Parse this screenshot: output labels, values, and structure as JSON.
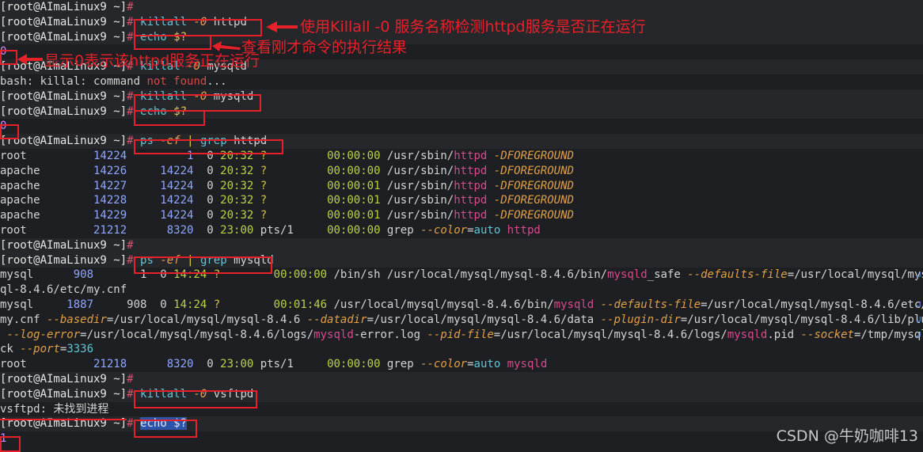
{
  "prompt": "[root@AImaLinux9 ~]",
  "lines": [
    {
      "t": "prompt",
      "rest": ""
    },
    {
      "t": "prompt",
      "cmd": "killall",
      "flag": "-0",
      "arg": "httpd"
    },
    {
      "t": "prompt",
      "cmd": "echo",
      "arg": "$?"
    },
    {
      "t": "num",
      "text": "0"
    },
    {
      "t": "prompt",
      "cmd": "killal",
      "flag": "-0",
      "arg": "mysqld"
    },
    {
      "t": "err",
      "a": "bash: killal: command ",
      "b": "not found",
      "c": "..."
    },
    {
      "t": "prompt",
      "cmd": "killall",
      "flag": "-0",
      "arg": "mysqld"
    },
    {
      "t": "prompt",
      "cmd": "echo",
      "arg": "$?"
    },
    {
      "t": "num",
      "text": "0"
    },
    {
      "t": "prompt",
      "ps": true,
      "arg": "httpd"
    },
    {
      "t": "ps",
      "user": "root",
      "pid": "14224",
      "ppid": "1",
      "c": "0",
      "stime": "20:32",
      "tty": "?",
      "time": "00:00:00",
      "path": "/usr/sbin/",
      "hl": "httpd",
      "opt": " -DFOREGROUND"
    },
    {
      "t": "ps",
      "user": "apache",
      "pid": "14226",
      "ppid": "14224",
      "c": "0",
      "stime": "20:32",
      "tty": "?",
      "time": "00:00:00",
      "path": "/usr/sbin/",
      "hl": "httpd",
      "opt": " -DFOREGROUND"
    },
    {
      "t": "ps",
      "user": "apache",
      "pid": "14227",
      "ppid": "14224",
      "c": "0",
      "stime": "20:32",
      "tty": "?",
      "time": "00:00:01",
      "path": "/usr/sbin/",
      "hl": "httpd",
      "opt": " -DFOREGROUND"
    },
    {
      "t": "ps",
      "user": "apache",
      "pid": "14228",
      "ppid": "14224",
      "c": "0",
      "stime": "20:32",
      "tty": "?",
      "time": "00:00:01",
      "path": "/usr/sbin/",
      "hl": "httpd",
      "opt": " -DFOREGROUND"
    },
    {
      "t": "ps",
      "user": "apache",
      "pid": "14229",
      "ppid": "14224",
      "c": "0",
      "stime": "20:32",
      "tty": "?",
      "time": "00:00:01",
      "path": "/usr/sbin/",
      "hl": "httpd",
      "opt": " -DFOREGROUND"
    },
    {
      "t": "psgrep",
      "user": "root",
      "pid": "21212",
      "ppid": "8320",
      "c": "0",
      "stime": "23:00",
      "tty": "pts/1",
      "time": "00:00:00",
      "word": "httpd"
    },
    {
      "t": "prompt",
      "rest": ""
    },
    {
      "t": "prompt",
      "ps": true,
      "arg": "mysqld"
    },
    {
      "t": "raw",
      "segs": [
        [
          "mysql      ",
          "c-arg"
        ],
        [
          "908",
          "c-pid"
        ],
        [
          "       1  0 ",
          "c-arg"
        ],
        [
          "14:24",
          "c-tm"
        ],
        [
          " ",
          "c-arg"
        ],
        [
          "?",
          "c-q"
        ],
        [
          "        ",
          "c-arg"
        ],
        [
          "00:00:00",
          "c-tm"
        ],
        [
          " /bin/sh /usr/local/mysql/mysql-8.4.6/bin/",
          "c-path"
        ],
        [
          "mysqld",
          "c-mag"
        ],
        [
          "_safe ",
          "c-path"
        ],
        [
          "--defaults-file",
          "c-opt"
        ],
        [
          "=/usr/local/mysql/mys",
          "c-path"
        ]
      ],
      "wrap": true
    },
    {
      "t": "raw",
      "segs": [
        [
          "ql-8.4.6/etc/my.cnf",
          "c-path"
        ]
      ]
    },
    {
      "t": "raw",
      "segs": [
        [
          "mysql     ",
          "c-arg"
        ],
        [
          "1887",
          "c-pid"
        ],
        [
          "     908  0 ",
          "c-arg"
        ],
        [
          "14:24",
          "c-tm"
        ],
        [
          " ",
          "c-arg"
        ],
        [
          "?",
          "c-q"
        ],
        [
          "        ",
          "c-arg"
        ],
        [
          "00:01:46",
          "c-tm"
        ],
        [
          " /usr/local/mysql/mysql-8.4.6/bin/",
          "c-path"
        ],
        [
          "mysqld",
          "c-mag"
        ],
        [
          " ",
          "c-path"
        ],
        [
          "--defaults-file",
          "c-opt"
        ],
        [
          "=/usr/local/mysql/mysql-8.4.6/etc/",
          "c-path"
        ]
      ],
      "wrap": true
    },
    {
      "t": "raw",
      "segs": [
        [
          "my.cnf ",
          "c-path"
        ],
        [
          "--basedir",
          "c-opt"
        ],
        [
          "=/usr/local/mysql/mysql-8.4.6 ",
          "c-path"
        ],
        [
          "--datadir",
          "c-opt"
        ],
        [
          "=/usr/local/mysql/mysql-8.4.6/data ",
          "c-path"
        ],
        [
          "--plugin-dir",
          "c-opt"
        ],
        [
          "=/usr/local/mysql/mysql-8.4.6/lib/plugin",
          "c-path"
        ]
      ],
      "wrap": true
    },
    {
      "t": "raw",
      "segs": [
        [
          " ",
          "c-path"
        ],
        [
          "--log-error",
          "c-opt"
        ],
        [
          "=/usr/local/mysql/mysql-8.4.6/logs/",
          "c-path"
        ],
        [
          "mysqld",
          "c-mag"
        ],
        [
          "-error.log ",
          "c-path"
        ],
        [
          "--pid-file",
          "c-opt"
        ],
        [
          "=/usr/local/mysql/mysql-8.4.6/logs/",
          "c-path"
        ],
        [
          "mysqld",
          "c-mag"
        ],
        [
          ".pid ",
          "c-path"
        ],
        [
          "--socket",
          "c-opt"
        ],
        [
          "=/tmp/mysql.so",
          "c-path"
        ]
      ],
      "wrap": true
    },
    {
      "t": "raw",
      "segs": [
        [
          "ck ",
          "c-path"
        ],
        [
          "--port",
          "c-opt"
        ],
        [
          "=",
          "c-path"
        ],
        [
          "3336",
          "c-val"
        ]
      ]
    },
    {
      "t": "psgrep",
      "user": "root",
      "pid": "21218",
      "ppid": "8320",
      "c": "0",
      "stime": "23:00",
      "tty": "pts/1",
      "time": "00:00:00",
      "word": "mysqld"
    },
    {
      "t": "prompt",
      "rest": ""
    },
    {
      "t": "prompt",
      "cmd": "killall",
      "flag": "-0",
      "arg": "vsftpd"
    },
    {
      "t": "raw",
      "segs": [
        [
          "vsftpd: 未找到进程",
          "c-path"
        ]
      ]
    },
    {
      "t": "prompt",
      "cmd": "echo",
      "arg": "$?",
      "selected": true
    },
    {
      "t": "num",
      "text": "1"
    }
  ],
  "annotations": {
    "a1": "使用Killall -0 服务名称检测httpd服务是否正在运行",
    "a2": "查看刚才命令的执行结果",
    "a3": "显示0表示该httpd服务正在运行"
  },
  "watermark": "CSDN @牛奶咖啡13",
  "icons": {
    "wrap": "line-wrap-icon"
  },
  "colors": {
    "annotation": "#e8202a",
    "background": "#1e1f22"
  }
}
